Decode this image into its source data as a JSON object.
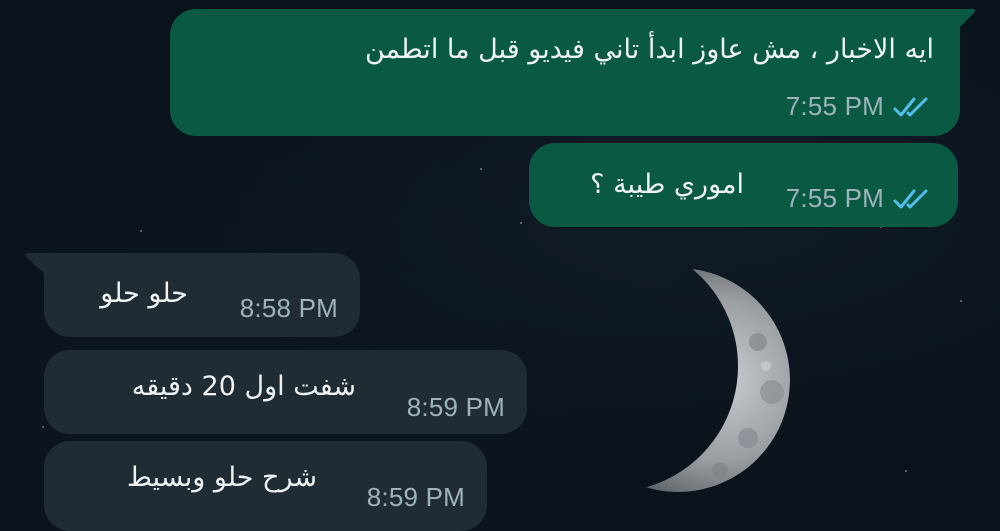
{
  "colors": {
    "outgoing_bubble": "#0a5a43",
    "incoming_bubble": "#1f2c33",
    "read_ticks": "#53bdeb",
    "timestamp": "#9fb3bb",
    "text": "#eef2f3"
  },
  "messages": [
    {
      "direction": "outgoing",
      "text": "ايه الاخبار ، مش عاوز ابدأ تاني فيديو قبل ما اتطمن",
      "time": "7:55 PM",
      "status_icon": "double-check-read-icon"
    },
    {
      "direction": "outgoing",
      "text": "اموري طيبة ؟",
      "time": "7:55 PM",
      "status_icon": "double-check-read-icon"
    },
    {
      "direction": "incoming",
      "text": "حلو حلو",
      "time": "8:58 PM"
    },
    {
      "direction": "incoming",
      "text": "شفت اول 20 دقيقه",
      "time": "8:59 PM"
    },
    {
      "direction": "incoming",
      "text": "شرح حلو وبسيط",
      "time": "8:59 PM"
    }
  ]
}
